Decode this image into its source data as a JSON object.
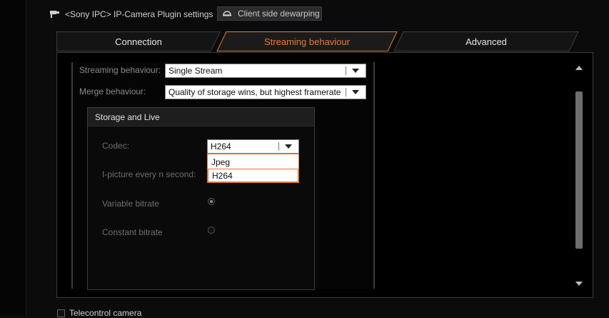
{
  "header": {
    "plugin_title": "<Sony IPC> IP-Camera Plugin settings",
    "dewarp_button": "Client side dewarping"
  },
  "tabs": [
    {
      "label": "Connection",
      "active": false
    },
    {
      "label": "Streaming behaviour",
      "active": true
    },
    {
      "label": "Advanced",
      "active": false
    }
  ],
  "streaming": {
    "streaming_label": "Streaming behaviour:",
    "streaming_value": "Single Stream",
    "merge_label": "Merge behaviour:",
    "merge_value": "Quality of storage wins, but highest framerate"
  },
  "storage_group": {
    "title": "Storage and Live",
    "codec_label": "Codec:",
    "codec_value": "H264",
    "codec_options": [
      "Jpeg",
      "H264"
    ],
    "ipicture_label": "I-picture every n second:",
    "variable_bitrate_label": "Variable bitrate",
    "constant_bitrate_label": "Constant bitrate",
    "variable_bitrate_checked": true,
    "constant_bitrate_checked": false
  },
  "bottom": {
    "telecontrol_label": "Telecontrol camera"
  },
  "colors": {
    "accent": "#e07b35",
    "background": "#0b0b0b"
  },
  "icons": {
    "camera": "camera-icon",
    "dewarp": "dewarp-dome-icon",
    "dropdown": "chevron-down-icon"
  }
}
